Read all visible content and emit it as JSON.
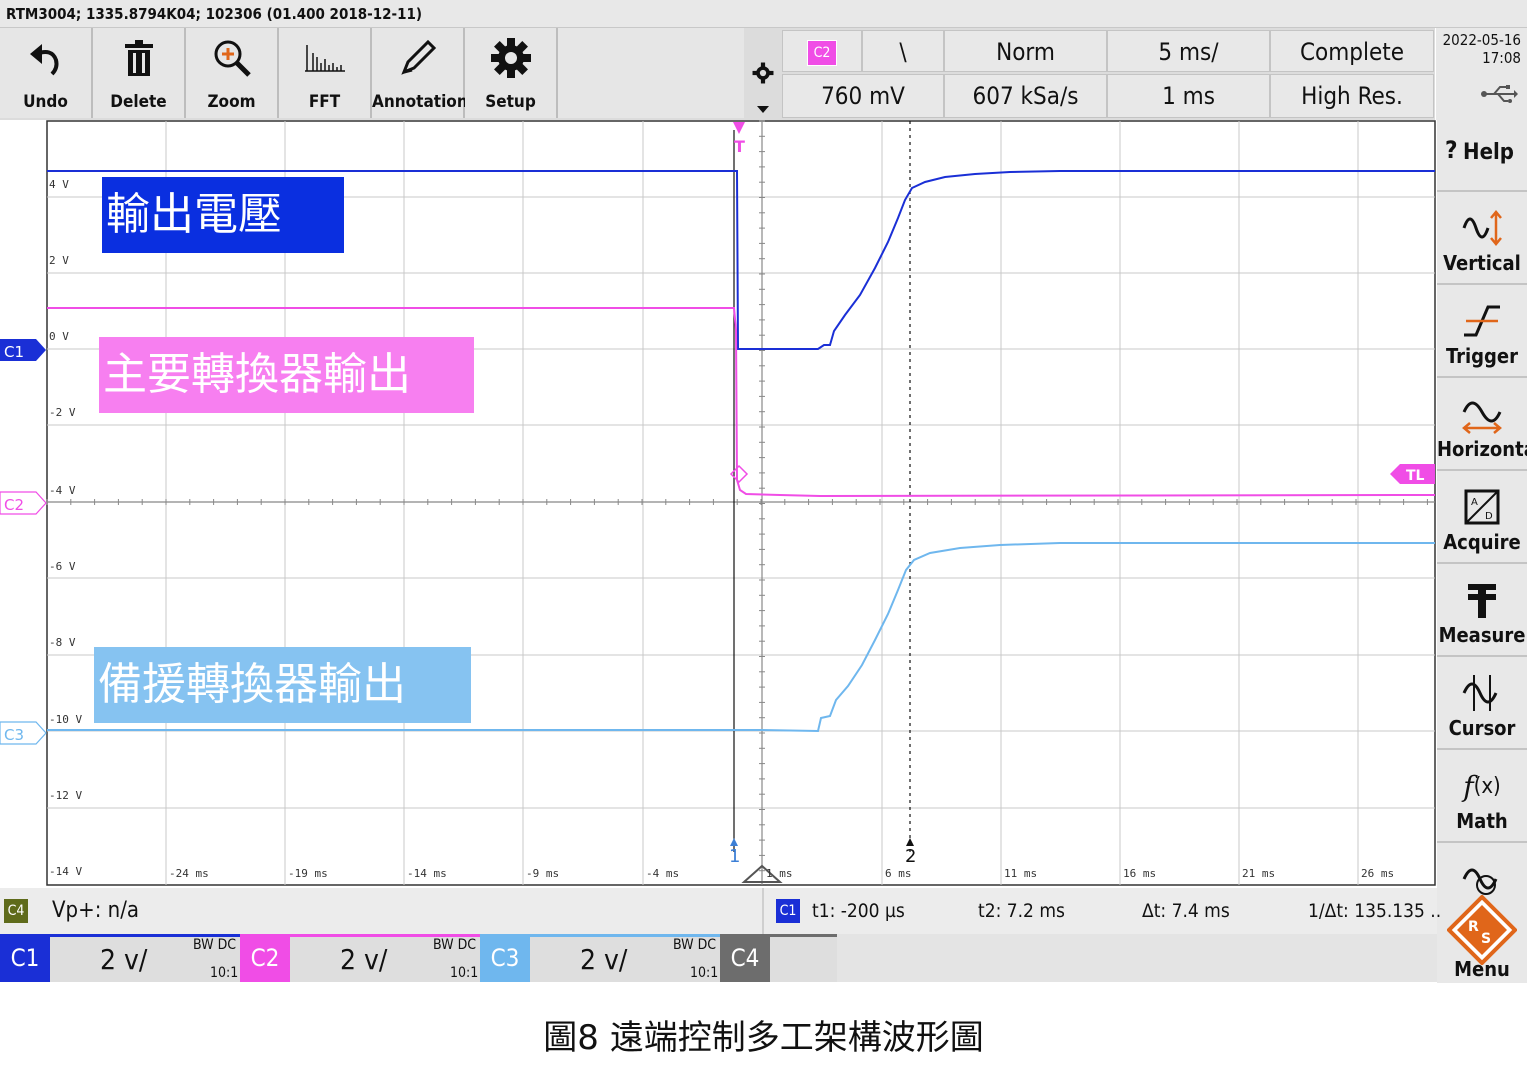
{
  "header": {
    "title": "RTM3004; 1335.8794K04; 102306 (01.400 2018-12-11)"
  },
  "toolbar": {
    "items": [
      "Undo",
      "Delete",
      "Zoom",
      "FFT",
      "Annotation",
      "Setup"
    ]
  },
  "acq": {
    "ch_tag": "C2",
    "slope_symbol": "\\",
    "mode": "Norm",
    "timebase": "5 ms/",
    "status": "Complete",
    "level": "760 mV",
    "samplerate": "607 kSa/s",
    "hres": "1 ms",
    "acq_mode": "High Res."
  },
  "datetime": {
    "date": "2022-05-16",
    "time": "17:08"
  },
  "side_menu": [
    "Help",
    "Vertical",
    "Trigger",
    "Horizontal",
    "Acquire",
    "Measure",
    "Cursor",
    "Math",
    "Menu"
  ],
  "screen": {
    "volt_labels": [
      "4 V",
      "2 V",
      "0 V",
      "-2 V",
      "-4 V",
      "-6 V",
      "-8 V",
      "-10 V",
      "-12 V",
      "-14 V"
    ],
    "time_labels": [
      "-24 ms",
      "-19 ms",
      "-14 ms",
      "-9 ms",
      "-4 ms",
      "1 ms",
      "6 ms",
      "11 ms",
      "16 ms",
      "21 ms",
      "26 ms"
    ],
    "markers": {
      "c1": "C1",
      "c2": "C2",
      "c3": "C3",
      "tl": "TL",
      "trig": "T",
      "cursor1": "1",
      "cursor2": "2"
    }
  },
  "annotations": {
    "output": "輸出電壓",
    "primary": "主要轉換器輸出",
    "backup": "備援轉換器輸出"
  },
  "colors": {
    "c1": "#1a2fd6",
    "c2": "#f04de6",
    "c3": "#6fb7ee",
    "c4": "#5f6b1b"
  },
  "measure_bar": {
    "ch4_tag": "C4",
    "vp": "Vp+: n/a",
    "ch_tag": "C1",
    "t1": "t1: -200 µs",
    "t2": "t2: 7.2 ms",
    "dt": "Δt: 7.4 ms",
    "inv_dt": "1/Δt: 135.135 .."
  },
  "channels": [
    {
      "tag": "C1",
      "scale": "2 v/",
      "bw": "BW DC",
      "probe": "10:1"
    },
    {
      "tag": "C2",
      "scale": "2 v/",
      "bw": "BW DC",
      "probe": "10:1"
    },
    {
      "tag": "C3",
      "scale": "2 v/",
      "bw": "BW DC",
      "probe": "10:1"
    },
    {
      "tag": "C4"
    }
  ],
  "caption": "圖8 遠端控制多工架構波形圖"
}
